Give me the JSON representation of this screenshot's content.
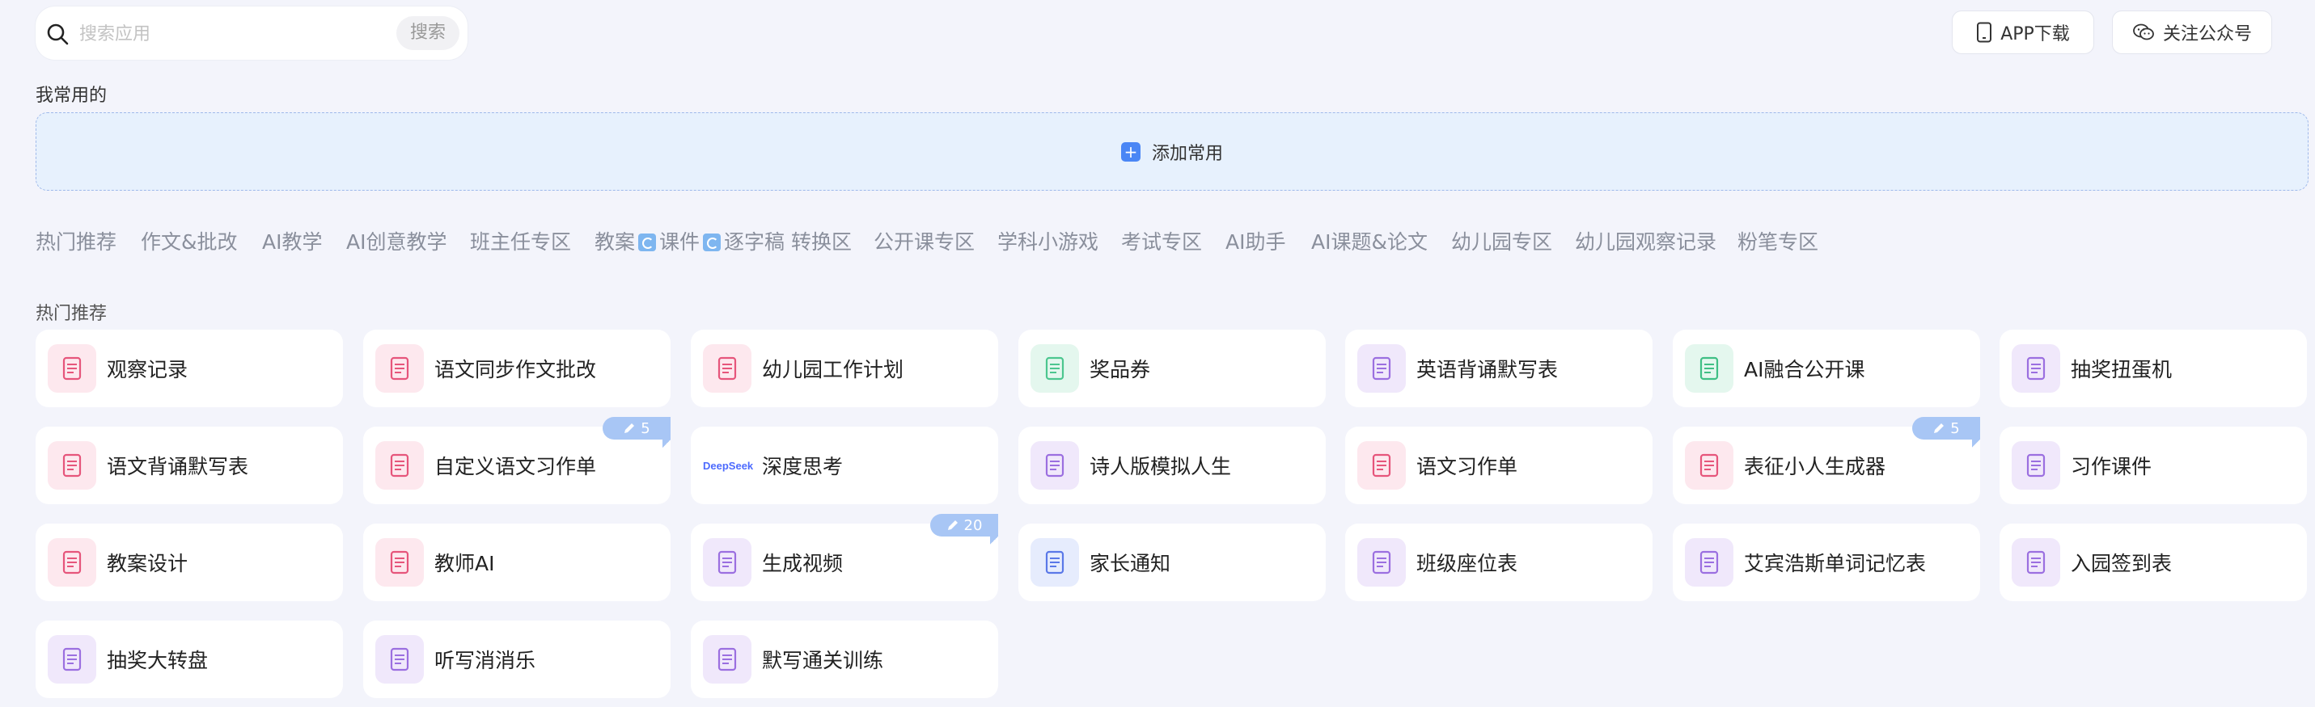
{
  "search": {
    "placeholder": "搜索应用",
    "button": "搜索"
  },
  "header": {
    "app_download": "APP下载",
    "follow_wechat": "关注公众号"
  },
  "favorites": {
    "title": "我常用的",
    "add_label": "添加常用"
  },
  "categories": [
    "热门推荐",
    "作文&批改",
    "AI教学",
    "AI创意教学",
    "班主任专区",
    "教案",
    "课件",
    "逐字稿 转换区",
    "公开课专区",
    "学科小游戏",
    "考试专区",
    "AI助手",
    "AI课题&论文",
    "幼儿园专区",
    "幼儿园观察记录",
    "粉笔专区"
  ],
  "hot": {
    "title": "热门推荐",
    "cards": [
      {
        "label": "观察记录",
        "icon": "observation-record-icon"
      },
      {
        "label": "语文同步作文批改",
        "icon": "essay-correction-icon"
      },
      {
        "label": "幼儿园工作计划",
        "icon": "kindergarten-plan-icon"
      },
      {
        "label": "奖品券",
        "icon": "prize-ticket-icon"
      },
      {
        "label": "英语背诵默写表",
        "icon": "english-recite-sheet-icon"
      },
      {
        "label": "AI融合公开课",
        "icon": "ai-open-class-icon"
      },
      {
        "label": "抽奖扭蛋机",
        "icon": "gacha-machine-icon"
      },
      {
        "label": "语文背诵默写表",
        "icon": "chinese-recite-sheet-icon"
      },
      {
        "label": "自定义语文习作单",
        "icon": "custom-writing-sheet-icon",
        "badge": "5"
      },
      {
        "label": "深度思考",
        "icon": "deepseek-logo",
        "logo_text": "DeepSeek"
      },
      {
        "label": "诗人版模拟人生",
        "icon": "poet-avatar-icon"
      },
      {
        "label": "语文习作单",
        "icon": "writing-sheet-icon"
      },
      {
        "label": "表征小人生成器",
        "icon": "figure-generator-icon",
        "badge": "5"
      },
      {
        "label": "习作课件",
        "icon": "writing-courseware-icon"
      },
      {
        "label": "教案设计",
        "icon": "lesson-plan-icon"
      },
      {
        "label": "教师AI",
        "icon": "teacher-ai-icon"
      },
      {
        "label": "生成视频",
        "icon": "video-generator-icon",
        "badge": "20"
      },
      {
        "label": "家长通知",
        "icon": "parent-notice-icon"
      },
      {
        "label": "班级座位表",
        "icon": "seating-chart-icon"
      },
      {
        "label": "艾宾浩斯单词记忆表",
        "icon": "ebbinghaus-memory-icon"
      },
      {
        "label": "入园签到表",
        "icon": "check-in-sheet-icon"
      },
      {
        "label": "抽奖大转盘",
        "icon": "lucky-wheel-icon"
      },
      {
        "label": "听写消消乐",
        "icon": "dictation-game-icon"
      },
      {
        "label": "默写通关训练",
        "icon": "dictation-training-icon"
      }
    ]
  }
}
